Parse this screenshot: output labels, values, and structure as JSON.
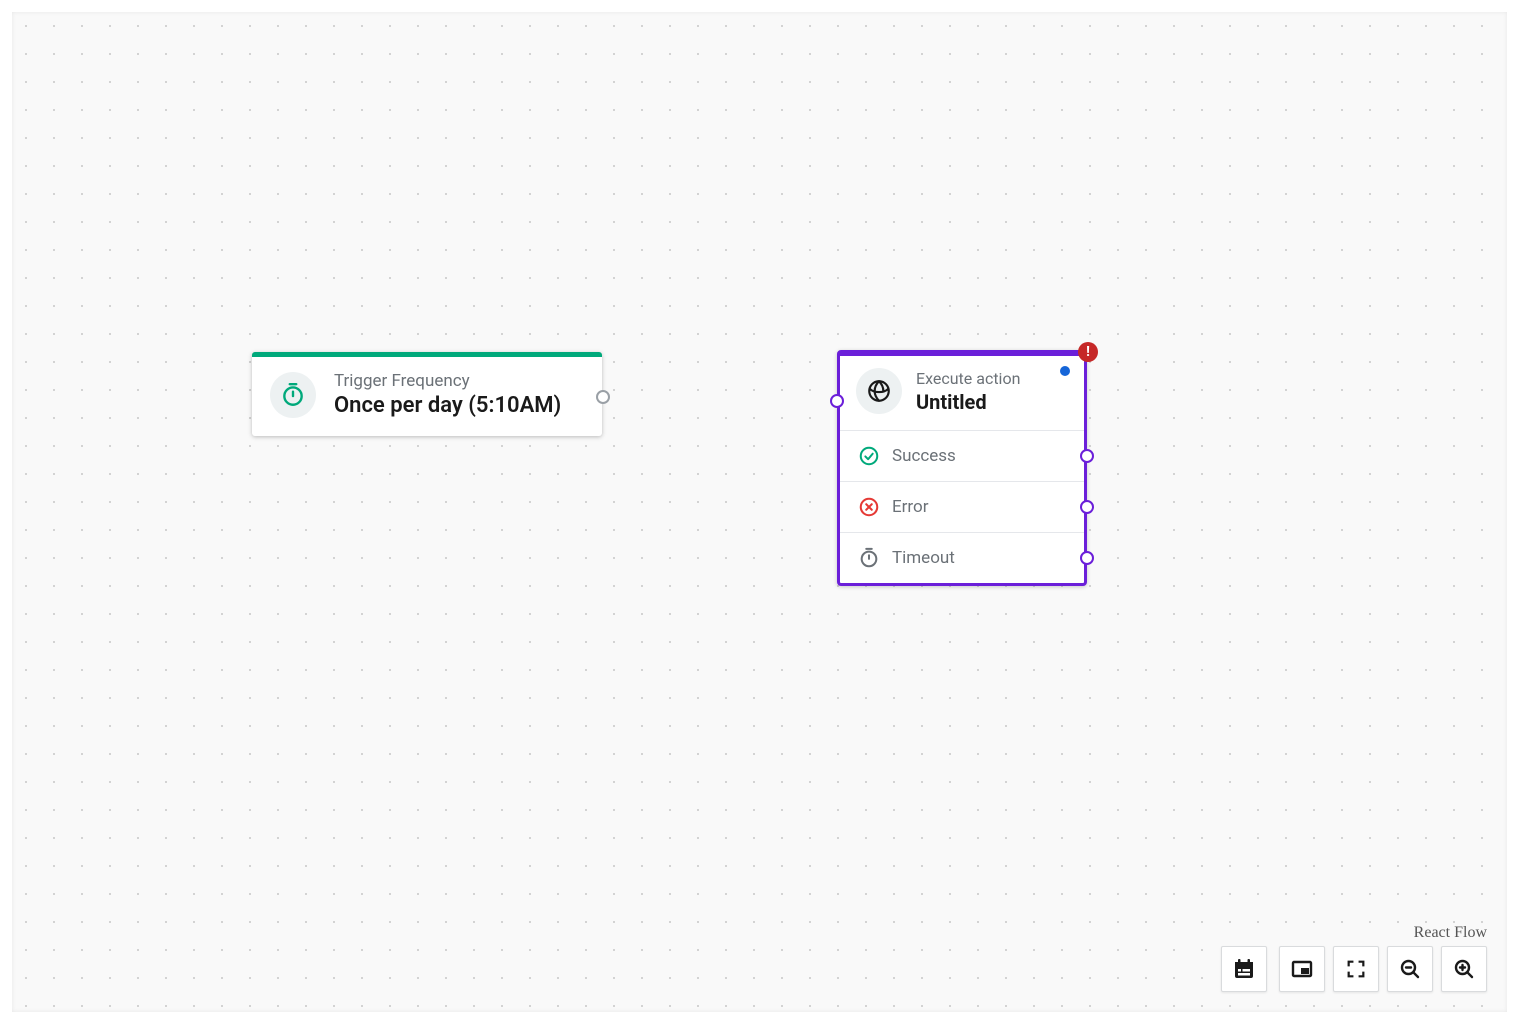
{
  "trigger": {
    "label": "Trigger Frequency",
    "value": "Once per day (5:10AM)"
  },
  "action": {
    "type_label": "Execute action",
    "title": "Untitled",
    "warning_badge": "!",
    "outcomes": {
      "success": "Success",
      "error": "Error",
      "timeout": "Timeout"
    }
  },
  "attribution": "React Flow"
}
